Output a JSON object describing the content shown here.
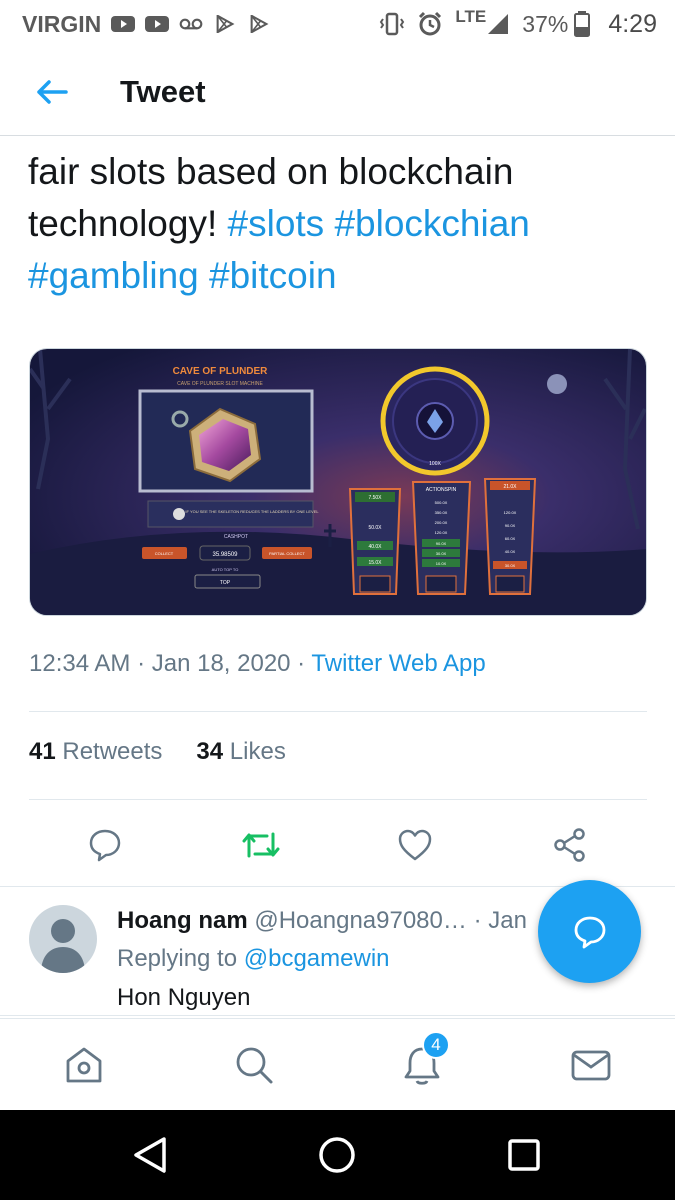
{
  "status_bar": {
    "carrier": "VIRGIN",
    "network": "LTE",
    "battery": "37%",
    "time": "4:29",
    "icons": [
      "youtube-icon",
      "youtube-icon",
      "voicemail-icon",
      "play-store-icon",
      "play-store-icon",
      "vibrate-icon",
      "alarm-icon",
      "signal-icon",
      "battery-icon"
    ]
  },
  "header": {
    "title": "Tweet",
    "back_icon": "back-arrow-icon"
  },
  "tweet": {
    "text_lines": [
      "fair slots based on blockchain",
      "technology! "
    ],
    "hashtags": [
      "#slots",
      "#blockchian",
      "#gambling",
      "#bitcoin"
    ],
    "media_title": "CAVE OF PLUNDER",
    "media_subtitle": "CAVE OF PLUNDER SLOT MACHINE",
    "media_labels": {
      "cashpot_label": "CASHPOT",
      "cashpot_value": "35.98509",
      "collect": "COLLECT",
      "partial_collect": "PARTIAL COLLECT",
      "auto_top": "AUTO TOP TO",
      "top": "TOP",
      "action_spin": "ACTIONSPIN",
      "skeleton_note": "IF YOU SEE THE SKELETON REDUCES THE LADDERS BY ONE LEVEL",
      "ladder_left": [
        "7.50X",
        "50.0X",
        "40.0X",
        "15.0X"
      ],
      "ladder_mid": [
        "500.0X",
        "350.0X",
        "200.0X",
        "120.0X",
        "90.0X",
        "30.0X",
        "10.0X"
      ],
      "ladder_right": [
        "21.0X",
        "120.0X",
        "90.0X",
        "60.0X",
        "40.0X",
        "30.0X"
      ],
      "wheel_top": "100X"
    },
    "timestamp": "12:34 AM · Jan 18, 2020 · ",
    "source": "Twitter Web App",
    "retweets_count": "41",
    "retweets_label": "Retweets",
    "likes_count": "34",
    "likes_label": "Likes"
  },
  "actions": [
    "reply-icon",
    "retweet-icon",
    "like-icon",
    "share-icon"
  ],
  "colors": {
    "accent": "#1da1f2",
    "link": "#1b95e0",
    "retweet_green": "#17bf63",
    "muted": "#657786"
  },
  "reply": {
    "name": "Hoang nam",
    "handle": "@Hoangna97080…",
    "date": "· Jan",
    "replying_prefix": "Replying to ",
    "replying_to": "@bcgamewin",
    "text": "Hon Nguyen"
  },
  "bottom_nav": {
    "items": [
      "home-icon",
      "search-icon",
      "notifications-icon",
      "messages-icon"
    ],
    "notification_badge": "4"
  },
  "system_nav": [
    "back-icon",
    "home-icon",
    "recents-icon"
  ]
}
